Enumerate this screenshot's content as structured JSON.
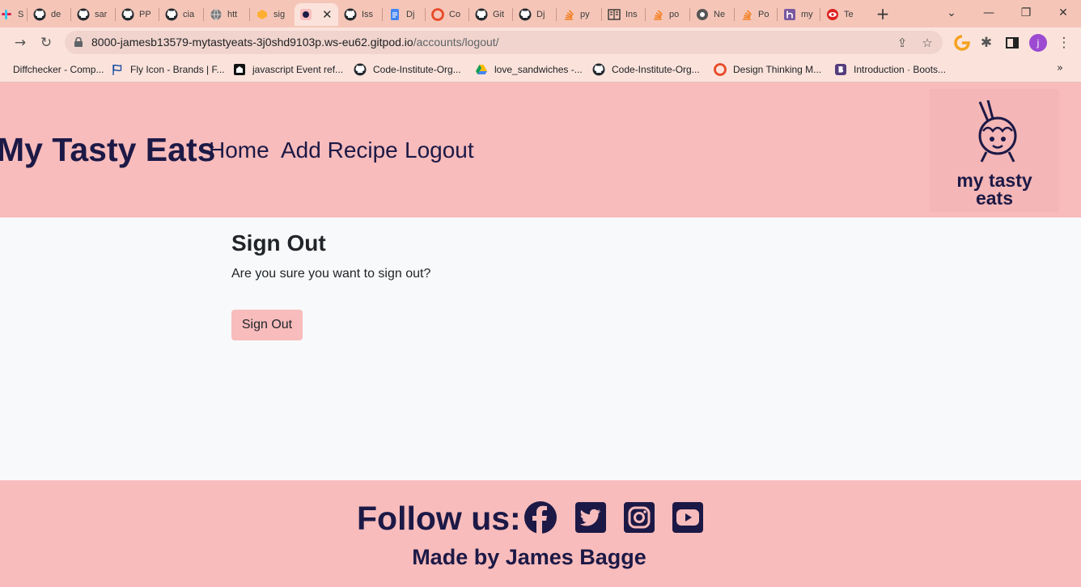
{
  "browser": {
    "tabs": [
      {
        "label": "Sla",
        "icon": "slack-icon"
      },
      {
        "label": "de",
        "icon": "github-icon"
      },
      {
        "label": "sar",
        "icon": "github-icon"
      },
      {
        "label": "PP",
        "icon": "github-icon"
      },
      {
        "label": "cia",
        "icon": "github-icon"
      },
      {
        "label": "htt",
        "icon": "globe-icon"
      },
      {
        "label": "sig",
        "icon": "gitpod-icon"
      },
      {
        "label": "",
        "icon": "mytastyeats-icon",
        "active": true
      },
      {
        "label": "Iss",
        "icon": "github-icon"
      },
      {
        "label": "Dj",
        "icon": "docs-icon"
      },
      {
        "label": "Co",
        "icon": "codeinstitute-icon"
      },
      {
        "label": "Git",
        "icon": "github-icon"
      },
      {
        "label": "Dj",
        "icon": "github-icon"
      },
      {
        "label": "py",
        "icon": "stackoverflow-icon"
      },
      {
        "label": "Ins",
        "icon": "reader-icon"
      },
      {
        "label": "po",
        "icon": "stackoverflow-icon"
      },
      {
        "label": "Ne",
        "icon": "chrome-icon"
      },
      {
        "label": "Po",
        "icon": "stackoverflow-icon"
      },
      {
        "label": "my",
        "icon": "heroku-icon"
      },
      {
        "label": "Te",
        "icon": "eye-icon"
      }
    ],
    "url": {
      "host": "8000-jamesb13579-mytastyeats-3j0shd9103p.ws-eu62.gitpod.io",
      "path": "/accounts/logout/"
    },
    "profile_initial": "j",
    "bookmarks": [
      {
        "label": "Diffchecker - Comp...",
        "icon": "diffchecker-icon"
      },
      {
        "label": "Fly Icon - Brands | F...",
        "icon": "flag-icon"
      },
      {
        "label": "javascript Event ref...",
        "icon": "w3schools-icon"
      },
      {
        "label": "Code-Institute-Org...",
        "icon": "github-icon"
      },
      {
        "label": "love_sandwiches -...",
        "icon": "google-drive-icon"
      },
      {
        "label": "Code-Institute-Org...",
        "icon": "github-icon"
      },
      {
        "label": "Design Thinking M...",
        "icon": "codeinstitute-icon"
      },
      {
        "label": "Introduction · Boots...",
        "icon": "bootstrap-icon"
      }
    ]
  },
  "header": {
    "brand": "My Tasty Eats",
    "nav": [
      "Home",
      "Add Recipe",
      "Logout"
    ],
    "logo": {
      "line1": "my tasty",
      "line2": "eats"
    }
  },
  "main": {
    "title": "Sign Out",
    "message": "Are you sure you want to sign out?",
    "button": "Sign Out"
  },
  "footer": {
    "follow": "Follow us:",
    "social": [
      "facebook-icon",
      "twitter-icon",
      "instagram-icon",
      "youtube-icon"
    ],
    "made_by": "Made by James Bagge"
  },
  "colors": {
    "accent_pink": "#f8bcbc",
    "navy": "#1c1946",
    "chrome_tab": "#f5c6b8",
    "page_bg": "#f8f9fa"
  }
}
